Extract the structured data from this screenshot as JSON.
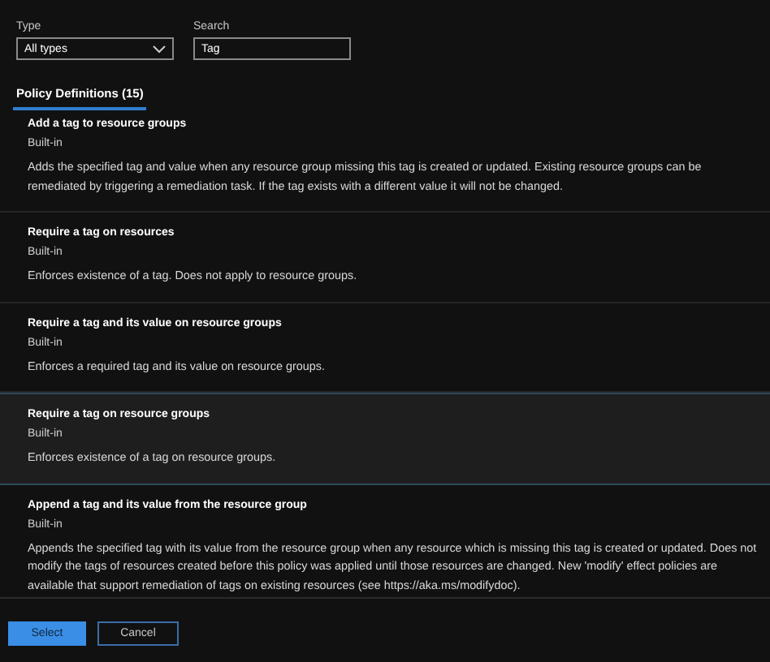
{
  "filters": {
    "type": {
      "label": "Type",
      "value": "All types"
    },
    "search": {
      "label": "Search",
      "value": "Tag"
    }
  },
  "tabs": [
    {
      "label": "Policy Definitions (15)",
      "selected": true
    }
  ],
  "policies": [
    {
      "name": "Add a tag to resource groups",
      "source": "Built-in",
      "description": "Adds the specified tag and value when any resource group missing this tag is created or updated. Existing resource groups can be remediated by triggering a remediation task. If the tag exists with a different value it will not be changed.",
      "selected": false
    },
    {
      "name": "Require a tag on resources",
      "source": "Built-in",
      "description": "Enforces existence of a tag. Does not apply to resource groups.",
      "selected": false
    },
    {
      "name": "Require a tag and its value on resource groups",
      "source": "Built-in",
      "description": "Enforces a required tag and its value on resource groups.",
      "selected": false
    },
    {
      "name": "Require a tag on resource groups",
      "source": "Built-in",
      "description": "Enforces existence of a tag on resource groups.",
      "selected": true
    },
    {
      "name": "Append a tag and its value from the resource group",
      "source": "Built-in",
      "description": "Appends the specified tag with its value from the resource group when any resource which is missing this tag is created or updated. Does not modify the tags of resources created before this policy was applied until those resources are changed. New 'modify' effect policies are available that support remediation of tags on existing resources (see https://aka.ms/modifydoc).",
      "selected": false
    }
  ],
  "buttons": [
    {
      "label": "Select",
      "kind": "primary"
    },
    {
      "label": "Cancel",
      "kind": "secondary"
    }
  ]
}
